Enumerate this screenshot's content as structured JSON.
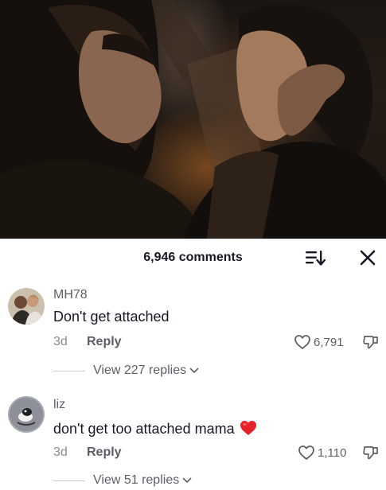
{
  "header": {
    "comments_count": "6,946 comments",
    "sort_icon": "sort-icon",
    "close_icon": "close-icon"
  },
  "comments": [
    {
      "username": "MH78",
      "text": "Don't get attached",
      "time": "3d",
      "reply_label": "Reply",
      "likes": "6,791",
      "view_replies": "View 227 replies"
    },
    {
      "username": "liz",
      "text": "don't get too attached mama",
      "emoji": "red-heart",
      "time": "3d",
      "reply_label": "Reply",
      "likes": "1,110",
      "view_replies": "View 51 replies"
    }
  ],
  "colors": {
    "text_primary": "#161823",
    "text_secondary": "#5e5f66",
    "text_muted": "#8a8b91",
    "heart_red": "#e8202a"
  }
}
